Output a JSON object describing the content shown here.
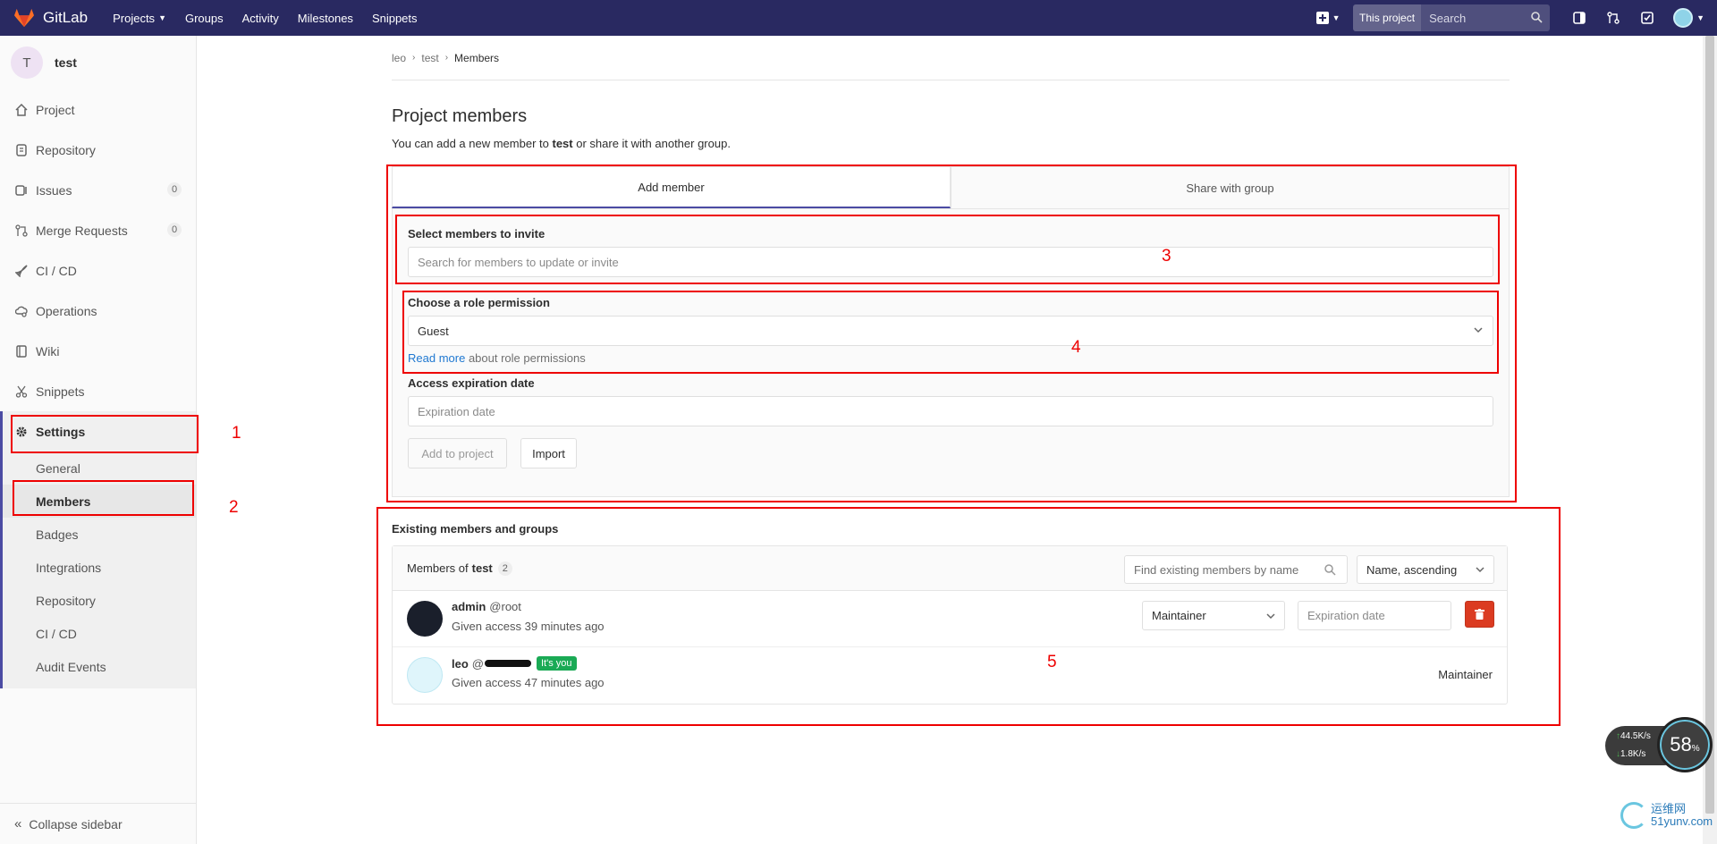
{
  "navbar": {
    "brand": "GitLab",
    "items": [
      {
        "label": "Projects",
        "has_caret": true
      },
      {
        "label": "Groups"
      },
      {
        "label": "Activity"
      },
      {
        "label": "Milestones"
      },
      {
        "label": "Snippets"
      }
    ],
    "search_scope": "This project",
    "search_placeholder": "Search",
    "colors": {
      "background": "#292961",
      "logo": "#fc6d26"
    }
  },
  "sidebar": {
    "project_initial": "T",
    "project_name": "test",
    "items": [
      {
        "label": "Project",
        "icon": "home-icon"
      },
      {
        "label": "Repository",
        "icon": "doc-icon"
      },
      {
        "label": "Issues",
        "icon": "issues-icon",
        "count": "0"
      },
      {
        "label": "Merge Requests",
        "icon": "merge-icon",
        "count": "0"
      },
      {
        "label": "CI / CD",
        "icon": "rocket-icon"
      },
      {
        "label": "Operations",
        "icon": "cloud-gear-icon"
      },
      {
        "label": "Wiki",
        "icon": "book-icon"
      },
      {
        "label": "Snippets",
        "icon": "scissors-icon"
      },
      {
        "label": "Settings",
        "icon": "gear-icon"
      }
    ],
    "settings_sub": [
      {
        "label": "General"
      },
      {
        "label": "Members",
        "active": true
      },
      {
        "label": "Badges"
      },
      {
        "label": "Integrations"
      },
      {
        "label": "Repository"
      },
      {
        "label": "CI / CD"
      },
      {
        "label": "Audit Events"
      }
    ],
    "collapse_label": "Collapse sidebar"
  },
  "breadcrumb": {
    "items": [
      "leo",
      "test",
      "Members"
    ]
  },
  "page": {
    "title": "Project members",
    "lead_pre": "You can add a new member to",
    "lead_project": "test",
    "lead_post": "or share it with another group."
  },
  "tabs": {
    "add_member": "Add member",
    "share_group": "Share with group"
  },
  "form": {
    "invite_label": "Select members to invite",
    "invite_placeholder": "Search for members to update or invite",
    "role_label": "Choose a role permission",
    "role_value": "Guest",
    "read_more": "Read more",
    "read_more_suffix": "about role permissions",
    "expiration_label": "Access expiration date",
    "expiration_placeholder": "Expiration date",
    "add_button": "Add to project",
    "import_button": "Import"
  },
  "existing": {
    "title": "Existing members and groups",
    "members_of": "Members of",
    "project": "test",
    "count": "2",
    "search_placeholder": "Find existing members by name",
    "sort_label": "Name, ascending",
    "members": [
      {
        "name": "admin",
        "handle": "@root",
        "access": "Given access 39 minutes ago",
        "role": "Maintainer",
        "expiration_placeholder": "Expiration date"
      },
      {
        "name": "leo",
        "handle": "@",
        "badge": "It's you",
        "access": "Given access 47 minutes ago",
        "role": "Maintainer"
      }
    ]
  },
  "annotations": [
    "1",
    "2",
    "3",
    "4",
    "5"
  ],
  "widget": {
    "upload": "44.5",
    "download": "1.8",
    "unit": "K/s",
    "percent": "58",
    "percent_sign": "%",
    "watermark_line1": "运维网",
    "watermark_line2": "51yunv.com"
  }
}
